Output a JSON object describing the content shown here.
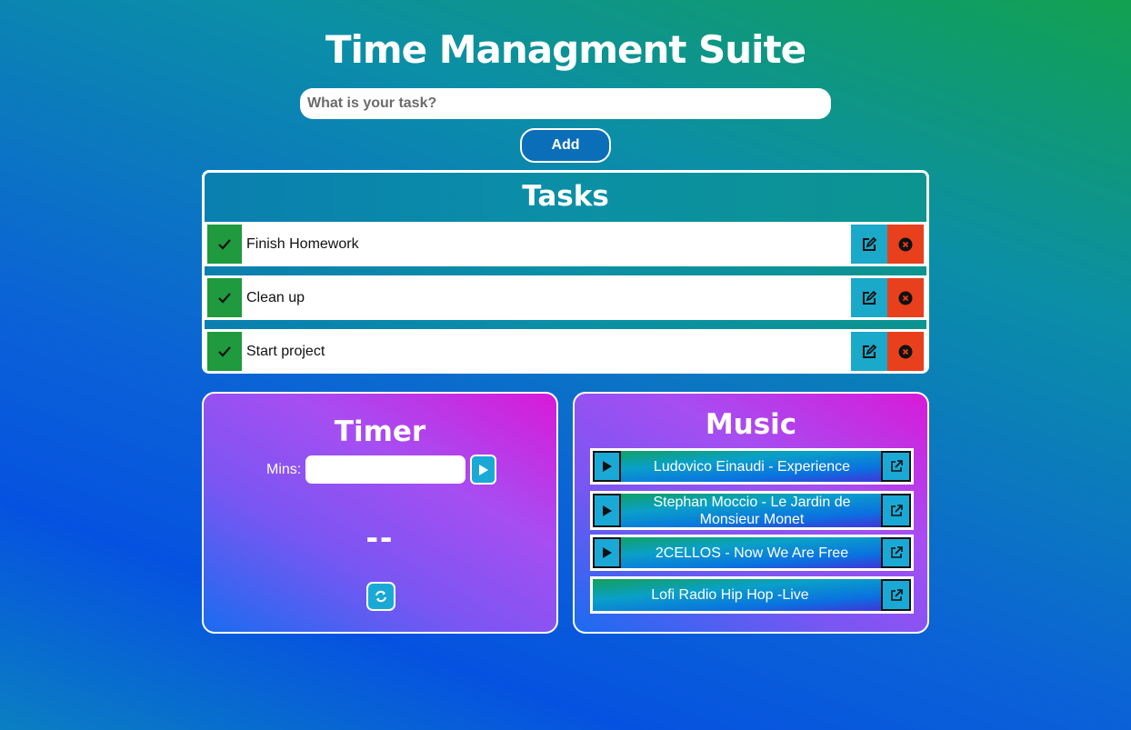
{
  "app": {
    "title": "Time Managment Suite"
  },
  "task_entry": {
    "placeholder": "What is your task?",
    "value": "",
    "add_label": "Add"
  },
  "tasks": {
    "title": "Tasks",
    "items": [
      {
        "label": "Finish Homework"
      },
      {
        "label": "Clean up"
      },
      {
        "label": "Start project"
      }
    ],
    "icons": {
      "complete": "check-icon",
      "edit": "edit-icon",
      "delete": "close-circle-icon"
    },
    "colors": {
      "complete": "#1f9a3e",
      "edit": "#1aa9c9",
      "delete": "#e8401c"
    }
  },
  "timer": {
    "title": "Timer",
    "mins_label": "Mins:",
    "mins_value": "",
    "display": "--",
    "icons": {
      "start": "play-icon",
      "reset": "refresh-icon"
    }
  },
  "music": {
    "title": "Music",
    "tracks": [
      {
        "name": "Ludovico Einaudi - Experience",
        "has_play": true
      },
      {
        "name": "Stephan Moccio - Le Jardin de Monsieur Monet",
        "has_play": true
      },
      {
        "name": "2CELLOS - Now We Are Free",
        "has_play": true
      },
      {
        "name": "Lofi Radio Hip Hop -Live",
        "has_play": false
      }
    ],
    "icons": {
      "play": "play-icon",
      "open": "external-link-icon"
    }
  }
}
